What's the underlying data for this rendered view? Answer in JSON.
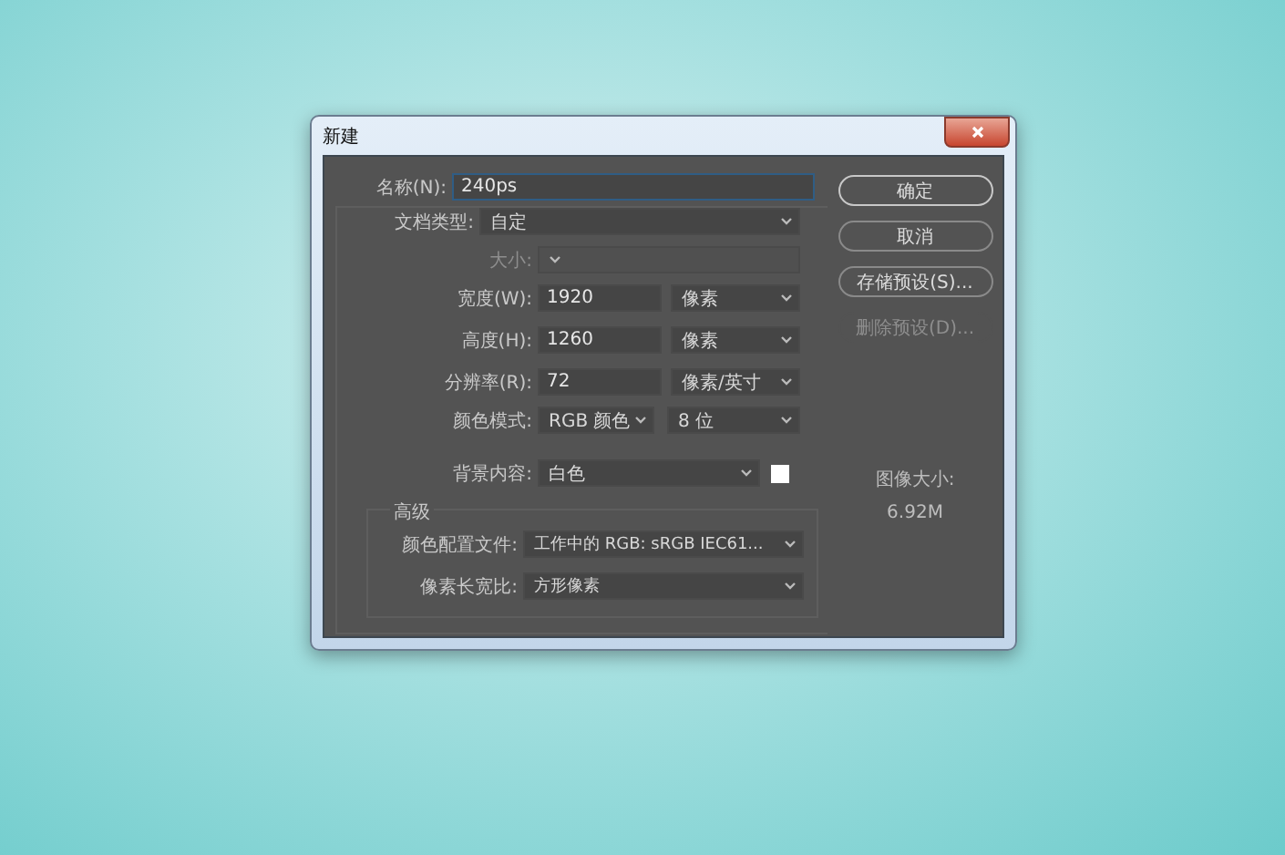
{
  "window": {
    "title": "新建"
  },
  "name": {
    "label": "名称(N):",
    "value": "240ps"
  },
  "fields": [
    {
      "kind": "select",
      "label": "文档类型:",
      "value": "自定",
      "disabled": false
    },
    {
      "kind": "select",
      "label": "大小:",
      "disabled": true
    },
    {
      "kind": "number_unit",
      "label": "宽度(W):",
      "value": "1920",
      "unit": "像素",
      "disabled": false
    },
    {
      "kind": "number_unit",
      "label": "高度(H):",
      "value": "1260",
      "unit": "像素",
      "disabled": false
    },
    {
      "kind": "number_unit",
      "label": "分辨率(R):",
      "value": "72",
      "unit": "像素/英寸",
      "disabled": false
    },
    {
      "kind": "select_pair",
      "label": "颜色模式:",
      "value": "RGB 颜色",
      "unit": "8 位",
      "disabled": false
    },
    {
      "kind": "select_swatch",
      "label": "背景内容:",
      "value": "白色",
      "disabled": false
    }
  ],
  "advanced": {
    "title": "高级",
    "fields": [
      {
        "label": "颜色配置文件:",
        "value": "工作中的 RGB: sRGB IEC61..."
      },
      {
        "label": "像素长宽比:",
        "value": "方形像素"
      }
    ]
  },
  "buttons": [
    {
      "label": "确定",
      "disabled": false,
      "default": true
    },
    {
      "label": "取消",
      "disabled": false,
      "default": false
    },
    {
      "label": "存储预设(S)...",
      "disabled": false,
      "default": false
    },
    {
      "label": "删除预设(D)...",
      "disabled": true,
      "default": false
    }
  ],
  "image_size": {
    "label": "图像大小:",
    "value": "6.92M"
  }
}
